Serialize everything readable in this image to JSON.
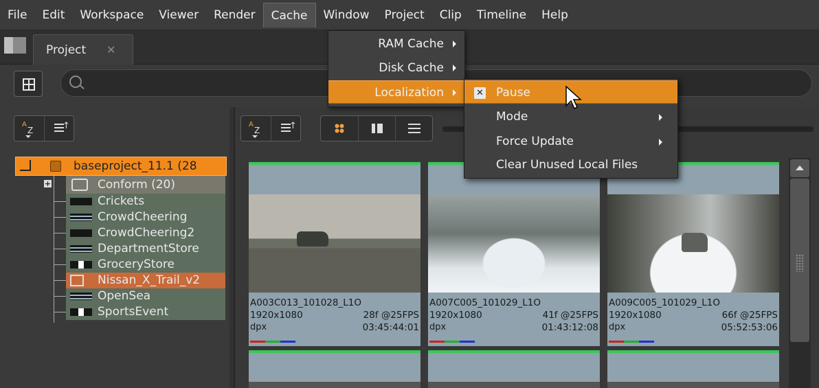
{
  "menubar": {
    "items": [
      "File",
      "Edit",
      "Workspace",
      "Viewer",
      "Render",
      "Cache",
      "Window",
      "Project",
      "Clip",
      "Timeline",
      "Help"
    ],
    "active": "Cache"
  },
  "tabs": {
    "project_label": "Project",
    "close_glyph": "✕"
  },
  "cache_menu": {
    "items": [
      {
        "label": "RAM Cache"
      },
      {
        "label": "Disk Cache"
      },
      {
        "label": "Localization"
      }
    ],
    "highlighted": "Localization"
  },
  "localization_menu": {
    "items": [
      {
        "label": "Pause",
        "checked": true
      },
      {
        "label": "Mode",
        "submenu": true
      },
      {
        "label": "Force Update",
        "submenu": true
      },
      {
        "label": "Clear Unused Local Files"
      }
    ],
    "highlighted": "Pause",
    "check_glyph": "✕"
  },
  "tree": {
    "root": "baseproject_11.1 (28",
    "conform": "Conform (20)",
    "expander": "+",
    "items": [
      "Crickets",
      "CrowdCheering",
      "CrowdCheering2",
      "DepartmentStore",
      "GroceryStore",
      "Nissan_X_Trail_v2",
      "OpenSea",
      "SportsEvent"
    ],
    "selected": "Nissan_X_Trail_v2"
  },
  "sort": {
    "a": "A",
    "z": "Z"
  },
  "clips": [
    {
      "name": "A003C013_101028_L1O",
      "res": "1920x1080",
      "frames": "28f @25FPS",
      "format": "dpx",
      "timecode": "03:45:44:01"
    },
    {
      "name": "A007C005_101029_L1O",
      "res": "1920x1080",
      "frames": "41f @25FPS",
      "format": "dpx",
      "timecode": "01:43:12:08"
    },
    {
      "name": "A009C005_101029_L1O",
      "res": "1920x1080",
      "frames": "66f @25FPS",
      "format": "dpx",
      "timecode": "05:52:53:06"
    }
  ],
  "colors": {
    "accent": "#e38b1f",
    "selected_item": "#c86a3a",
    "bin_item": "#5d6d5e"
  }
}
